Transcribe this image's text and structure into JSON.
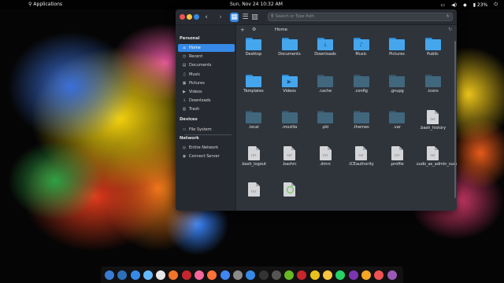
{
  "top_panel": {
    "applications_label": "Applications",
    "clock": "Sun, Nov 24   10:32 AM",
    "battery_percent": "23%"
  },
  "window": {
    "search_placeholder": "Search or Type Path",
    "path_label": "Home"
  },
  "sidebar": {
    "personal_heading": "Personal",
    "personal_items": [
      {
        "label": "Home",
        "icon": "home-icon"
      },
      {
        "label": "Recent",
        "icon": "recent-icon"
      },
      {
        "label": "Documents",
        "icon": "documents-icon"
      },
      {
        "label": "Music",
        "icon": "music-icon"
      },
      {
        "label": "Pictures",
        "icon": "pictures-icon"
      },
      {
        "label": "Videos",
        "icon": "videos-icon"
      },
      {
        "label": "Downloads",
        "icon": "downloads-icon"
      },
      {
        "label": "Trash",
        "icon": "trash-icon"
      }
    ],
    "devices_heading": "Devices",
    "device_items": [
      {
        "label": "File System",
        "icon": "drive-icon"
      }
    ],
    "network_heading": "Network",
    "network_items": [
      {
        "label": "Entire Network",
        "icon": "network-icon"
      },
      {
        "label": "Connect Server",
        "icon": "server-icon"
      }
    ]
  },
  "files": [
    {
      "name": "Desktop",
      "kind": "folder-blue",
      "emblem": ""
    },
    {
      "name": "Documents",
      "kind": "folder-blue",
      "emblem": ""
    },
    {
      "name": "Downloads",
      "kind": "folder-blue",
      "emblem": "↓"
    },
    {
      "name": "Music",
      "kind": "folder-blue",
      "emblem": "♪"
    },
    {
      "name": "Pictures",
      "kind": "folder-blue",
      "emblem": ""
    },
    {
      "name": "Public",
      "kind": "folder-blue",
      "emblem": ""
    },
    {
      "name": "Templates",
      "kind": "folder-blue",
      "emblem": ""
    },
    {
      "name": "Videos",
      "kind": "folder-blue",
      "emblem": "▶"
    },
    {
      "name": ".cache",
      "kind": "folder-dark",
      "emblem": ""
    },
    {
      "name": ".config",
      "kind": "folder-dark",
      "emblem": ""
    },
    {
      "name": ".gnupg",
      "kind": "folder-dark",
      "emblem": ""
    },
    {
      "name": ".icons",
      "kind": "folder-dark",
      "emblem": ""
    },
    {
      "name": ".local",
      "kind": "folder-dark",
      "emblem": ""
    },
    {
      "name": ".mozilla",
      "kind": "folder-dark",
      "emblem": ""
    },
    {
      "name": ".pki",
      "kind": "folder-dark",
      "emblem": ""
    },
    {
      "name": ".themes",
      "kind": "folder-dark",
      "emblem": ""
    },
    {
      "name": ".var",
      "kind": "folder-dark",
      "emblem": ""
    },
    {
      "name": ".bash_history",
      "kind": "text",
      "emblem": ""
    },
    {
      "name": ".bash_logout",
      "kind": "text",
      "emblem": ""
    },
    {
      "name": ".bashrc",
      "kind": "text",
      "emblem": ""
    },
    {
      "name": ".dmrc",
      "kind": "text",
      "emblem": ""
    },
    {
      "name": ".ICEauthority",
      "kind": "text",
      "emblem": ""
    },
    {
      "name": ".profile",
      "kind": "text",
      "emblem": ""
    },
    {
      "name": ".sudo_as_admin_successful",
      "kind": "text",
      "emblem": ""
    },
    {
      "name": "",
      "kind": "text",
      "emblem": ""
    },
    {
      "name": "",
      "kind": "text-green",
      "emblem": ""
    }
  ],
  "doc_badge": "TXT",
  "dock": [
    {
      "icon": "multitasking-view-icon",
      "color": "#3a7bd5"
    },
    {
      "icon": "workspaces-icon",
      "color": "#2d6fb8"
    },
    {
      "icon": "files-icon",
      "color": "#3689e6"
    },
    {
      "icon": "mail-icon",
      "color": "#64baff"
    },
    {
      "icon": "calendar-icon",
      "color": "#e8e8e8"
    },
    {
      "icon": "music-icon",
      "color": "#f37329"
    },
    {
      "icon": "videos-icon",
      "color": "#c6262e"
    },
    {
      "icon": "photos-icon",
      "color": "#f4679d"
    },
    {
      "icon": "firefox-icon",
      "color": "#ff7139"
    },
    {
      "icon": "chrome-icon",
      "color": "#4285f4"
    },
    {
      "icon": "settings-icon",
      "color": "#8a8a8a"
    },
    {
      "icon": "appcenter-icon",
      "color": "#3689e6"
    },
    {
      "icon": "terminal-icon",
      "color": "#333333"
    },
    {
      "icon": "screenshot-icon",
      "color": "#555555"
    },
    {
      "icon": "editor-icon",
      "color": "#68b723"
    },
    {
      "icon": "tool-icon",
      "color": "#c6262e"
    },
    {
      "icon": "archive-icon",
      "color": "#e8c21a"
    },
    {
      "icon": "notes-icon",
      "color": "#f9c440"
    },
    {
      "icon": "whatsapp-icon",
      "color": "#25d366"
    },
    {
      "icon": "app-icon",
      "color": "#7a36b1"
    },
    {
      "icon": "image-icon",
      "color": "#f5a623"
    },
    {
      "icon": "recorder-icon",
      "color": "#ed5353"
    },
    {
      "icon": "app2-icon",
      "color": "#9b59b6"
    }
  ]
}
